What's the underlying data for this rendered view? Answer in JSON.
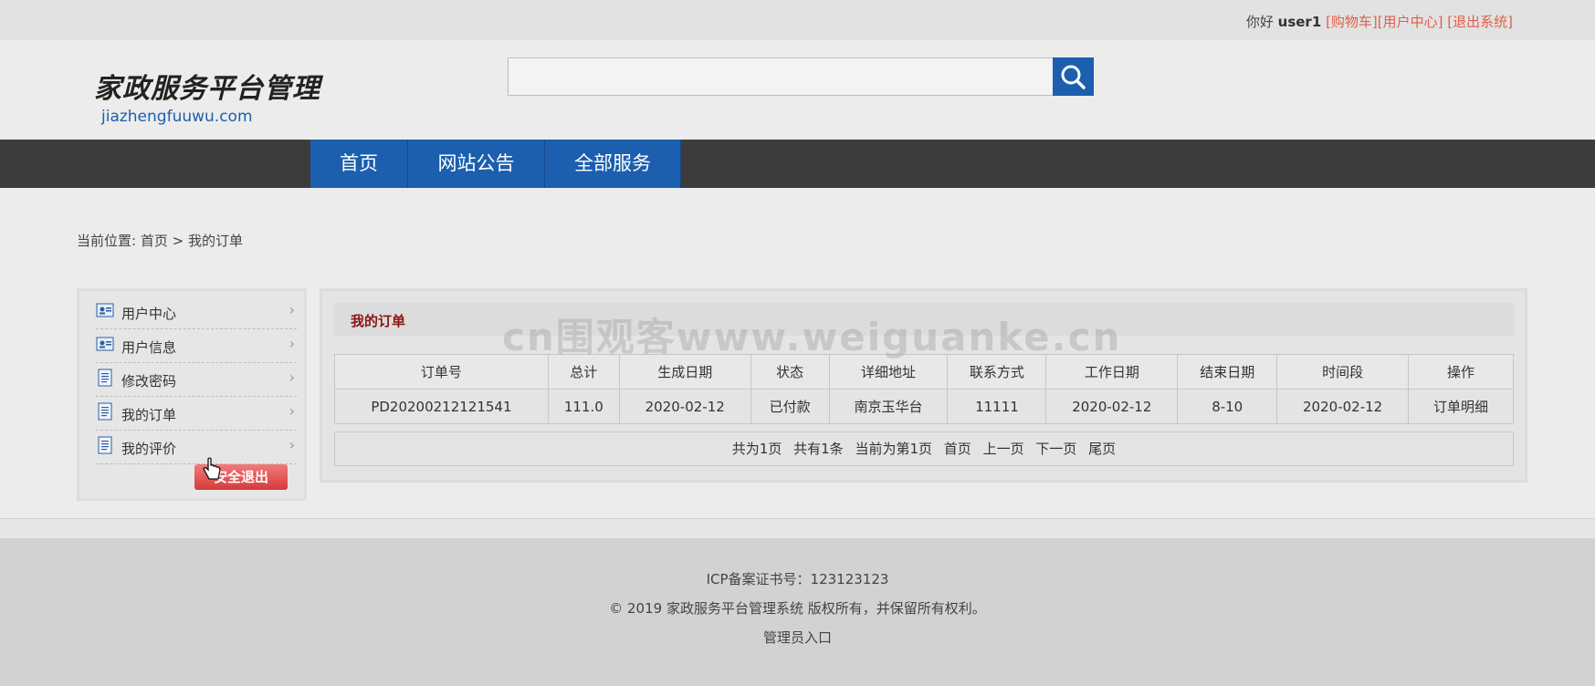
{
  "topbar": {
    "greeting": "你好",
    "username": "user1",
    "links": [
      "[购物车]",
      "[用户中心]",
      "[退出系统]"
    ]
  },
  "logo": {
    "cn_text": "家政服务平台管理",
    "en_text": "jiazhengfuuwu.com"
  },
  "search": {
    "value": "",
    "placeholder": "",
    "icon": "search-icon"
  },
  "nav": {
    "items": [
      "首页",
      "网站公告",
      "全部服务"
    ]
  },
  "breadcrumb": {
    "label": "当前位置:",
    "home": "首页",
    "separator": ">",
    "current": "我的订单"
  },
  "sidebar": {
    "items": [
      {
        "label": "用户中心",
        "icon": "user-card-icon"
      },
      {
        "label": "用户信息",
        "icon": "user-card-icon"
      },
      {
        "label": "修改密码",
        "icon": "document-icon"
      },
      {
        "label": "我的订单",
        "icon": "document-icon"
      },
      {
        "label": "我的评价",
        "icon": "document-icon"
      }
    ],
    "arrow": "›",
    "logout_label": "安全退出"
  },
  "main": {
    "title": "我的订单",
    "table": {
      "headers": [
        "订单号",
        "总计",
        "生成日期",
        "状态",
        "详细地址",
        "联系方式",
        "工作日期",
        "结束日期",
        "时间段",
        "操作"
      ],
      "rows": [
        [
          "PD20200212121541",
          "111.0",
          "2020-02-12",
          "已付款",
          "南京玉华台",
          "11111",
          "2020-02-12",
          "8-10",
          "2020-02-12",
          "订单明细"
        ]
      ]
    },
    "pager": {
      "total_pages": "共为1页",
      "total_items": "共有1条",
      "current": "当前为第1页",
      "first": "首页",
      "prev": "上一页",
      "next": "下一页",
      "last": "尾页"
    }
  },
  "watermark": "cn围观客www.weiguanke.cn",
  "footer": {
    "icp": "ICP备案证书号：123123123",
    "copyright": "© 2019 家政服务平台管理系统 版权所有，并保留所有权利。",
    "admin_link": "管理员入口"
  },
  "colors": {
    "brand_blue": "#1b5fae",
    "nav_dark": "#3c3c3c",
    "link_red": "#e0604a",
    "title_red": "#8a1414"
  }
}
